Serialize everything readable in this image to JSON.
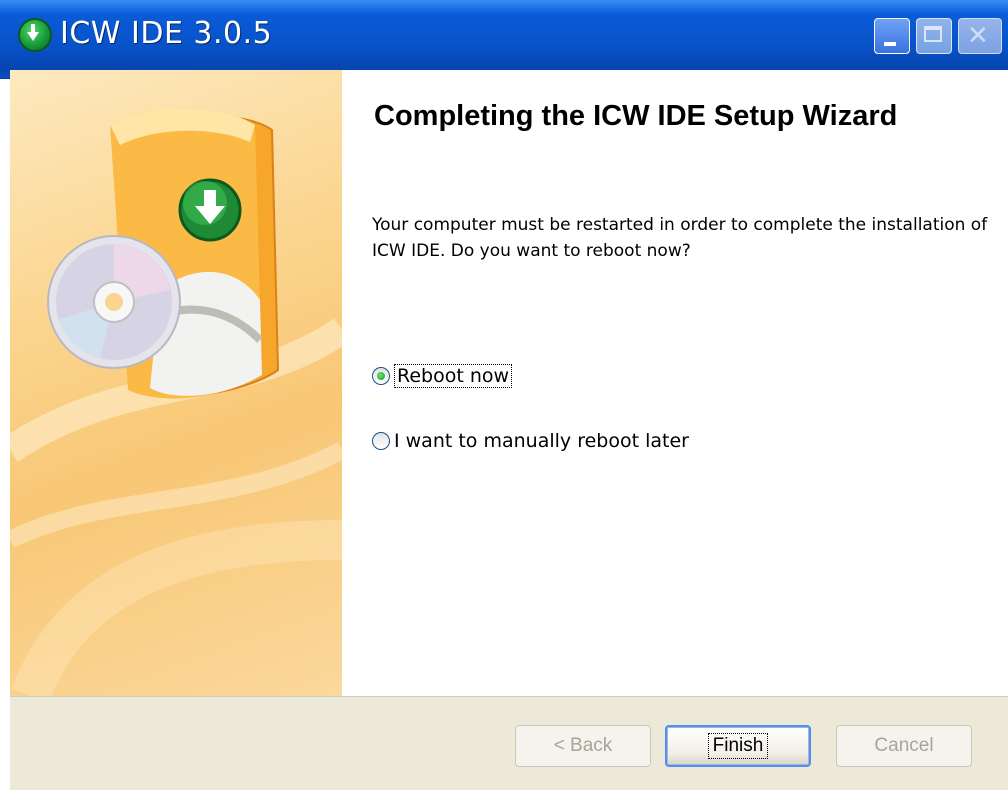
{
  "window": {
    "title": "ICW IDE 3.0.5",
    "icon": "download-arrow-icon"
  },
  "content": {
    "heading": "Completing the ICW IDE Setup Wizard",
    "description": "Your computer must be restarted in order to complete the installation of ICW IDE. Do you want to reboot now?",
    "options": [
      {
        "label": "Reboot now",
        "checked": true
      },
      {
        "label": "I want to manually reboot later",
        "checked": false
      }
    ]
  },
  "buttons": {
    "back": "< Back",
    "finish": "Finish",
    "cancel": "Cancel"
  },
  "colors": {
    "titlebar": "#0852c8",
    "banner": "#f8c775",
    "footer": "#ece9d8"
  }
}
